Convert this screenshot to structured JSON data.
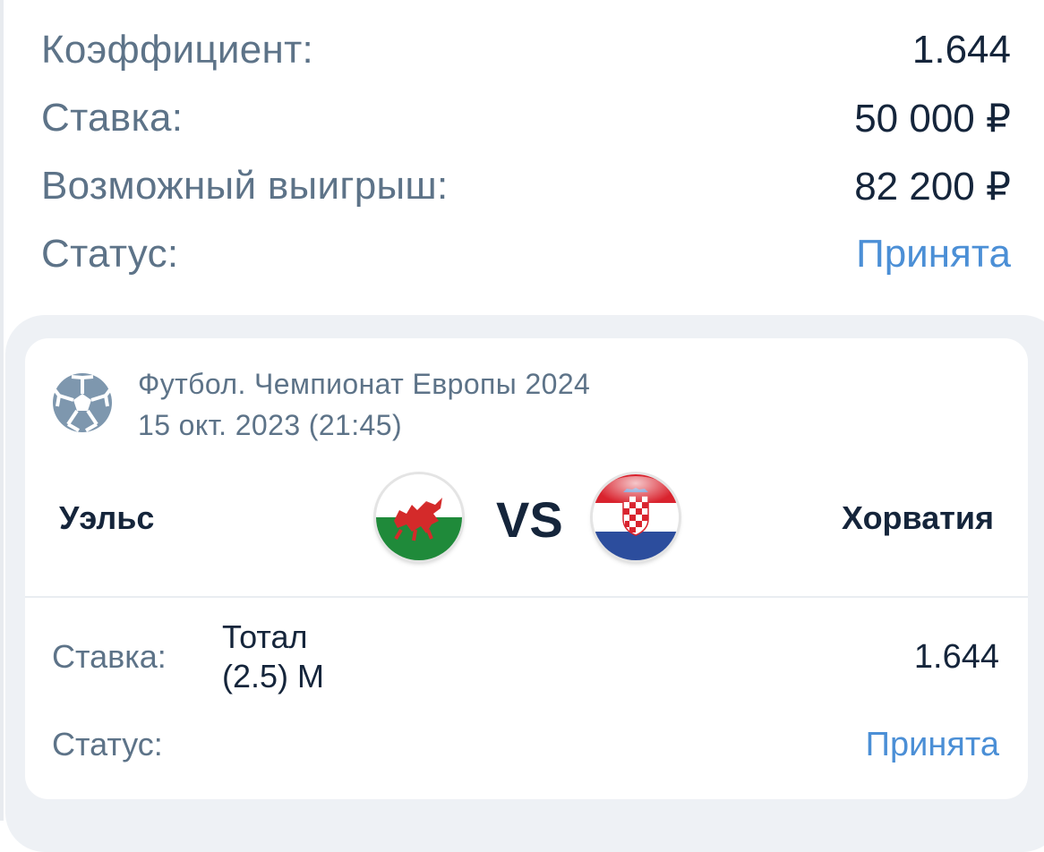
{
  "summary": {
    "coefficient_label": "Коэффициент:",
    "coefficient_value": "1.644",
    "stake_label": "Ставка:",
    "stake_value": "50 000 ₽",
    "possible_win_label": "Возможный выигрыш:",
    "possible_win_value": "82 200 ₽",
    "status_label": "Статус:",
    "status_value": "Принята"
  },
  "event": {
    "sport_icon": "soccer-ball-icon",
    "tournament": "Футбол. Чемпионат Европы 2024",
    "datetime": "15 окт. 2023 (21:45)",
    "home_team": "Уэльс",
    "home_flag": "wales-flag-icon",
    "vs_label": "VS",
    "away_team": "Хорватия",
    "away_flag": "croatia-flag-icon"
  },
  "bet": {
    "stake_label": "Ставка:",
    "stake_name": "Тотал (2.5) М",
    "coefficient": "1.644",
    "status_label": "Статус:",
    "status_value": "Принята"
  },
  "colors": {
    "label_gray": "#5d7388",
    "value_dark": "#15253b",
    "accent_blue": "#4b8fd6",
    "panel_bg": "#eef1f5"
  }
}
